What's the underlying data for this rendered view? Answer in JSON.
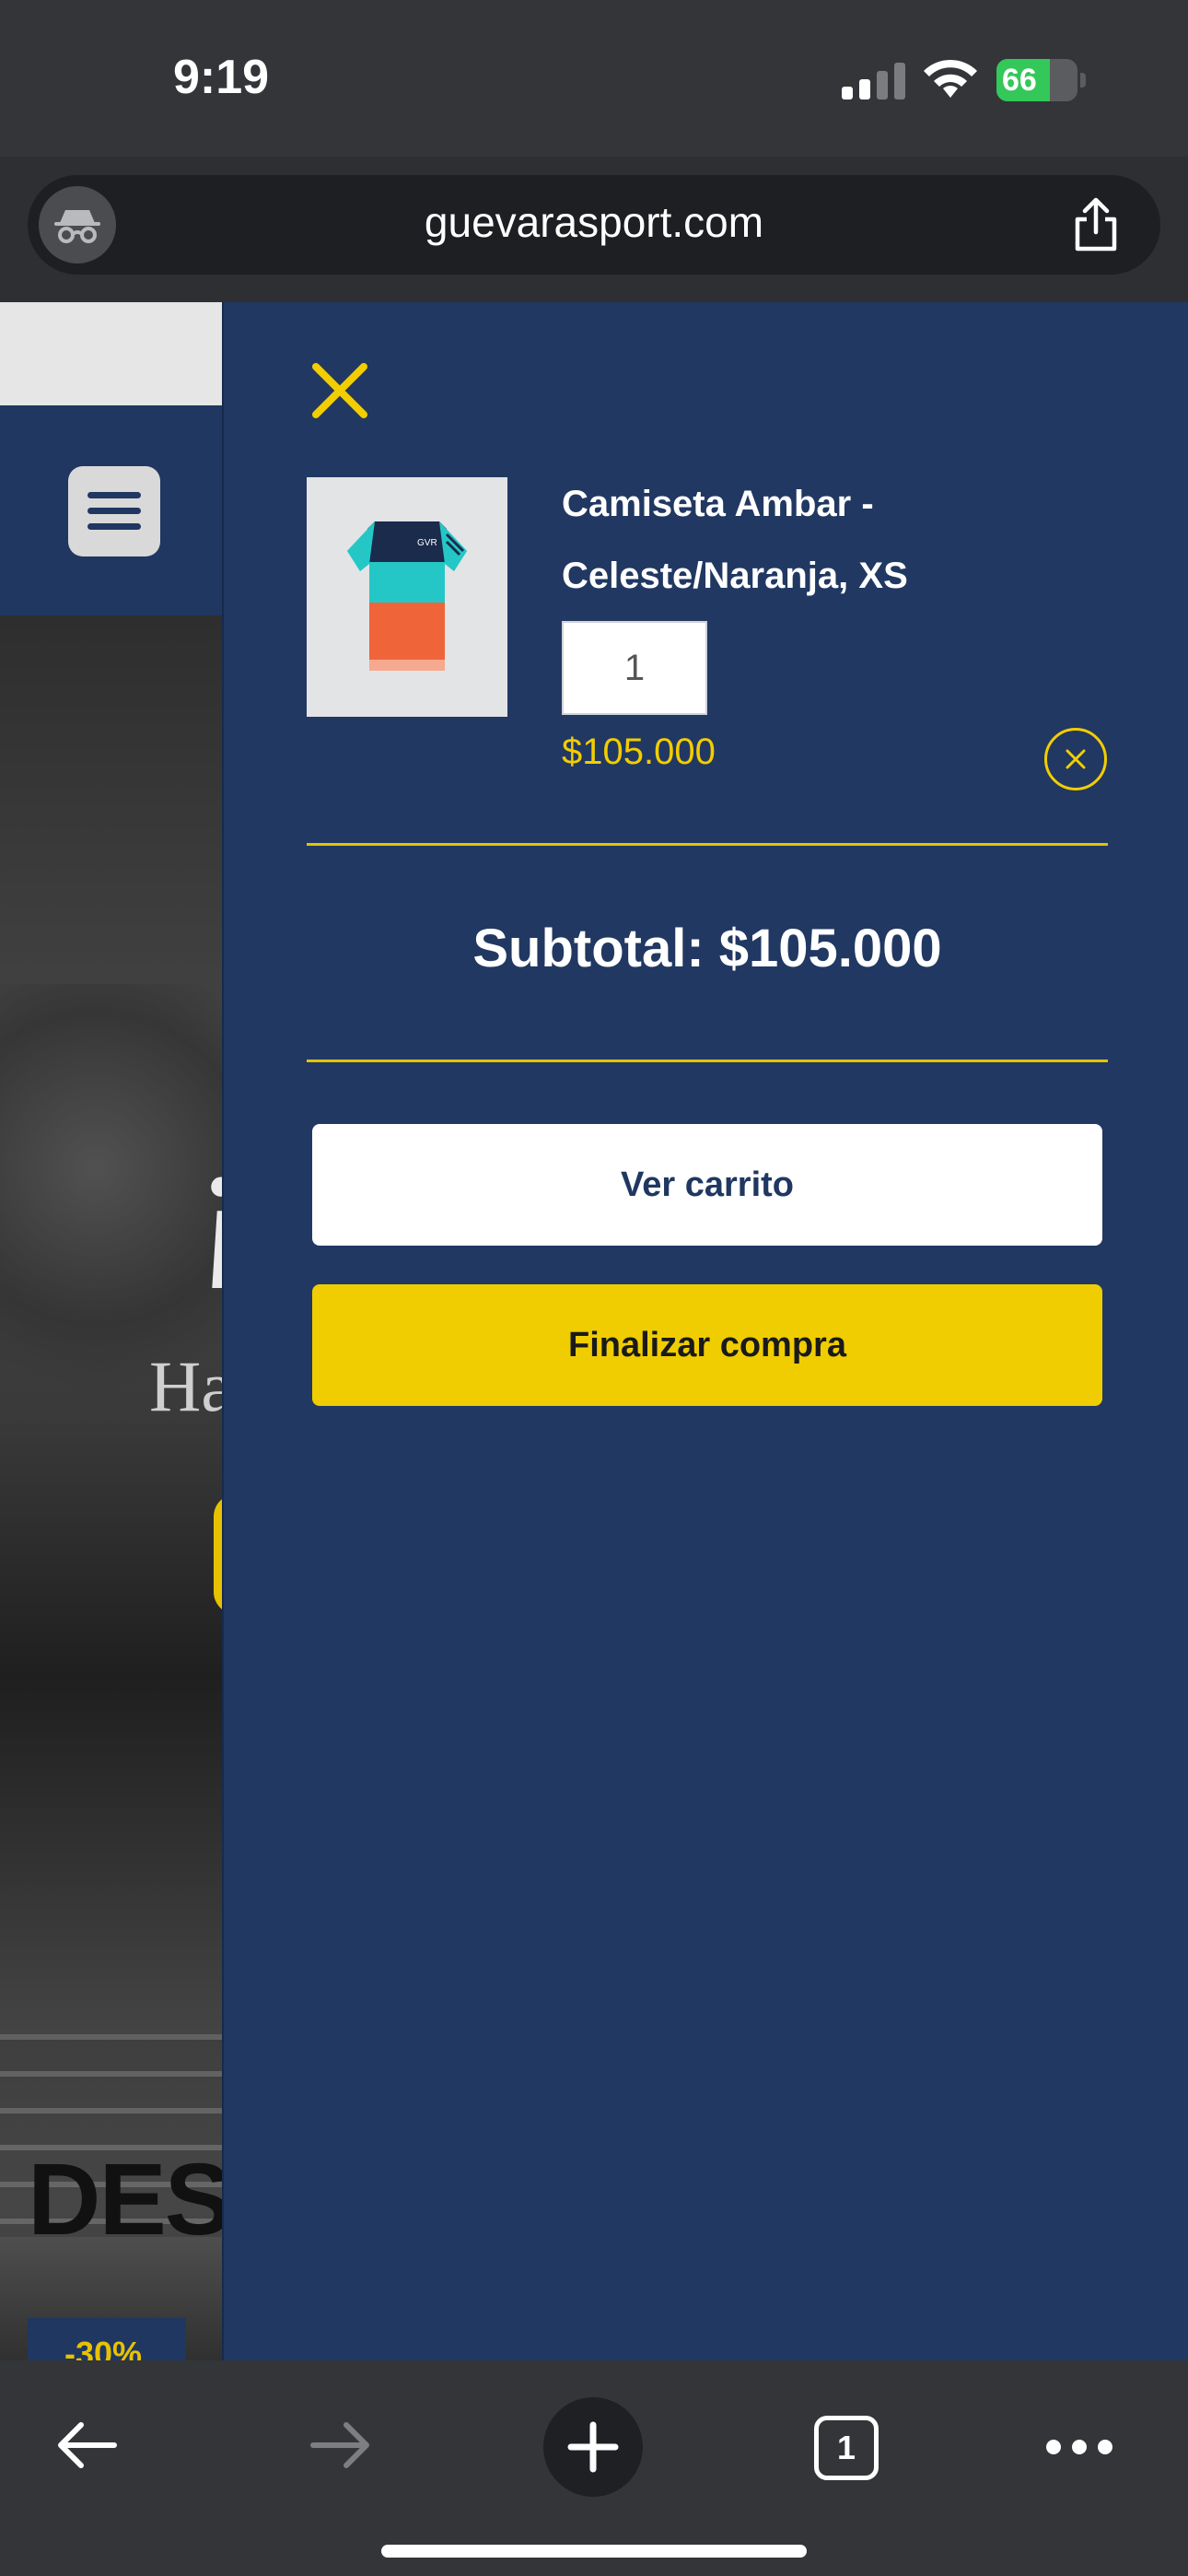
{
  "status_bar": {
    "time": "9:19",
    "battery_percent": "66",
    "battery_level": 0.66
  },
  "browser": {
    "url": "guevarasport.com",
    "incognito_icon": "incognito-icon",
    "share_icon": "share-icon"
  },
  "site_background": {
    "hero_title": "¡",
    "hero_subtitle": "Ha",
    "section_heading": "DES",
    "discount_badge": "-30%"
  },
  "cart": {
    "close_icon": "close-icon",
    "item": {
      "name": "Camiseta Ambar - Celeste/Naranja, XS",
      "quantity": "1",
      "price": "$105.000",
      "remove_icon": "remove-circle-icon"
    },
    "subtotal": "Subtotal: $105.000",
    "view_cart_label": "Ver carrito",
    "checkout_label": "Finalizar compra",
    "colors": {
      "panel": "#213862",
      "accent": "#f0cd00"
    }
  },
  "toolbar": {
    "back_icon": "back-arrow-icon",
    "forward_icon": "forward-arrow-icon",
    "new_tab_icon": "plus-icon",
    "tab_count": "1",
    "more_icon": "more-icon"
  }
}
